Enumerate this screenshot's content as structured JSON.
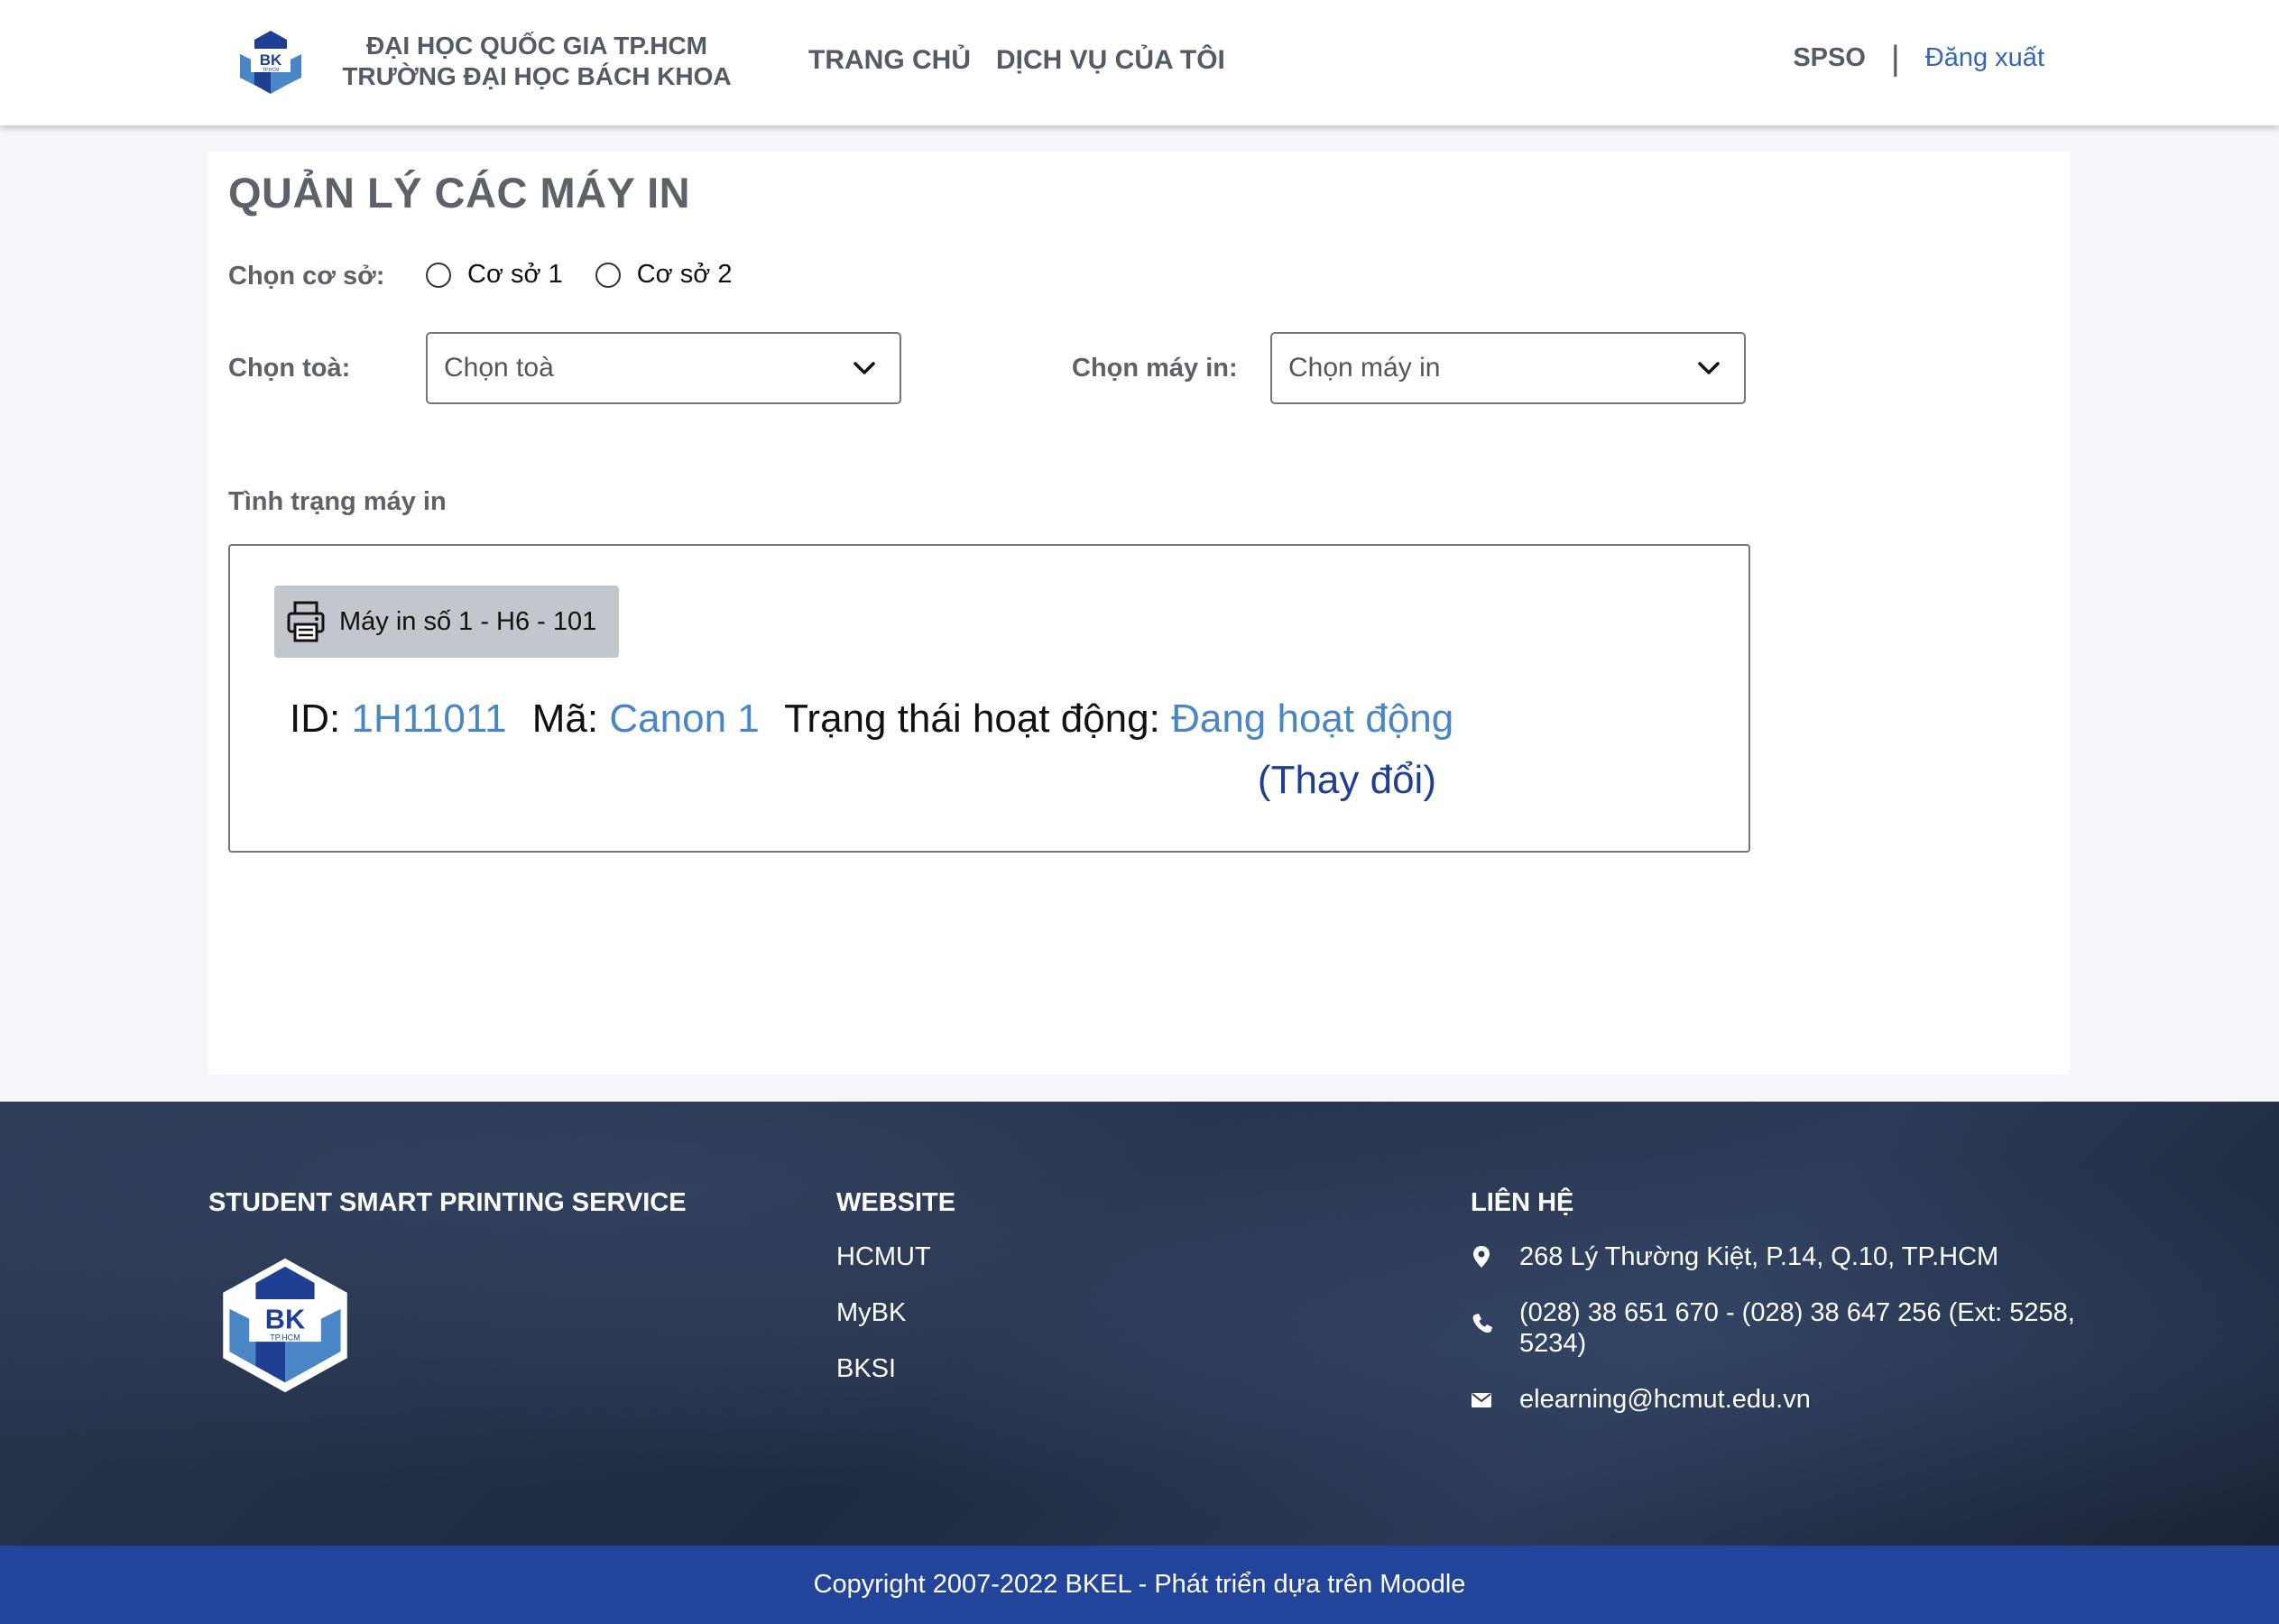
{
  "header": {
    "logo_text": "BK",
    "logo_subtext": "TP.HCM",
    "uni_line1": "ĐẠI HỌC QUỐC GIA TP.HCM",
    "uni_line2": "TRƯỜNG ĐẠI HỌC BÁCH KHOA",
    "nav": [
      "TRANG CHỦ",
      "DỊCH VỤ CỦA TÔI"
    ],
    "user": "SPSO",
    "separator": "|",
    "logout": "Đăng xuất"
  },
  "main": {
    "title": "QUẢN LÝ CÁC MÁY IN",
    "campus_label": "Chọn cơ sở:",
    "campus_options": [
      "Cơ sở 1",
      "Cơ sở 2"
    ],
    "building_label": "Chọn toà:",
    "building_value": "Chọn toà",
    "printer_label": "Chọn máy in:",
    "printer_value": "Chọn máy in",
    "status_label": "Tình trạng máy in",
    "printer_button": "Máy in số 1 - H6 - 101",
    "id_label": "ID:",
    "id_value": "1H11011",
    "code_label": "Mã:",
    "code_value": "Canon 1",
    "state_label": "Trạng thái hoạt động:",
    "state_value": "Đang hoạt động",
    "change_link": "(Thay đổi)"
  },
  "footer": {
    "col1_title": "STUDENT SMART PRINTING SERVICE",
    "col2_title": "WEBSITE",
    "links": [
      "HCMUT",
      "MyBK",
      "BKSI"
    ],
    "col3_title": "LIÊN HỆ",
    "address": "268 Lý Thường Kiệt, P.14, Q.10, TP.HCM",
    "phone": "(028) 38 651 670 - (028) 38 647 256 (Ext: 5258, 5234)",
    "email": "elearning@hcmut.edu.vn",
    "icons": [
      "map-pin-icon",
      "phone-icon",
      "mail-icon"
    ]
  },
  "copyright": "Copyright 2007-2022 BKEL - Phát triển dựa trên Moodle",
  "colors": {
    "accent": "#3566b8",
    "value_blue": "#4a86c6",
    "dark_blue": "#1f3f93",
    "copyright_bar": "#22449a"
  }
}
